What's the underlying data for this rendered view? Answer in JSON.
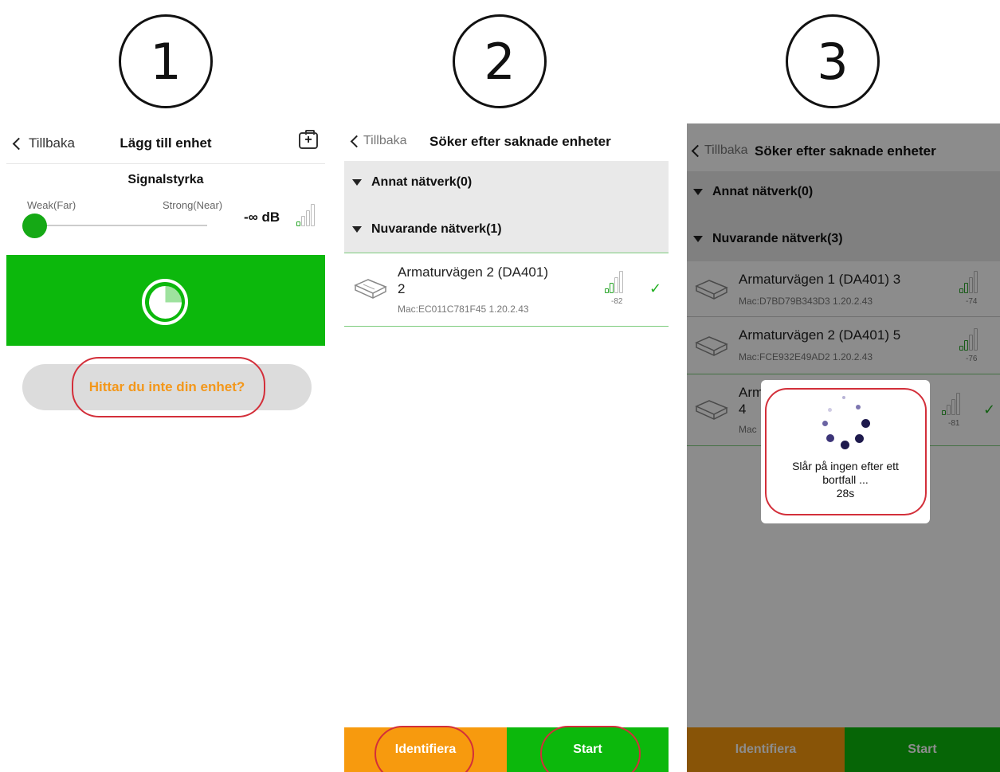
{
  "steps": [
    "1",
    "2",
    "3"
  ],
  "screen1": {
    "back_label": "Tillbaka",
    "title": "Lägg till enhet",
    "signal_title": "Signalstyrka",
    "weak_label": "Weak(Far)",
    "strong_label": "Strong(Near)",
    "db_value": "-∞ dB",
    "find_device_label": "Hittar du inte din enhet?",
    "colors": {
      "green": "#0cb80c",
      "orange": "#f3971a"
    }
  },
  "screen2": {
    "back_label": "Tillbaka",
    "title": "Söker efter saknade enheter",
    "section_other": "Annat nätverk(0)",
    "section_current": "Nuvarande nätverk(1)",
    "devices": [
      {
        "name": "Armaturvägen 2 (DA401)",
        "name_line2": "2",
        "mac": "Mac:EC011C781F45  1.20.2.43",
        "rssi": "-82"
      }
    ],
    "identify_label": "Identifiera",
    "start_label": "Start",
    "colors": {
      "identify": "#f79a0e",
      "start": "#0cb80c"
    }
  },
  "screen3": {
    "back_label": "Tillbaka",
    "title": "Söker efter saknade enheter",
    "section_other": "Annat nätverk(0)",
    "section_current": "Nuvarande nätverk(3)",
    "devices": [
      {
        "name": "Armaturvägen 1 (DA401) 3",
        "mac": "Mac:D7BD79B343D3  1.20.2.43",
        "rssi": "-74"
      },
      {
        "name": "Armaturvägen 2 (DA401) 5",
        "mac": "Mac:FCE932E49AD2  1.20.2.43",
        "rssi": "-76"
      },
      {
        "name": "Arm",
        "name_line2": "4",
        "mac": "Mac",
        "rssi": "-81"
      }
    ],
    "dialog_text_1": "Slår på ingen efter ett",
    "dialog_text_2": "bortfall ...",
    "dialog_countdown": "28s",
    "identify_label": "Identifiera",
    "start_label": "Start"
  }
}
